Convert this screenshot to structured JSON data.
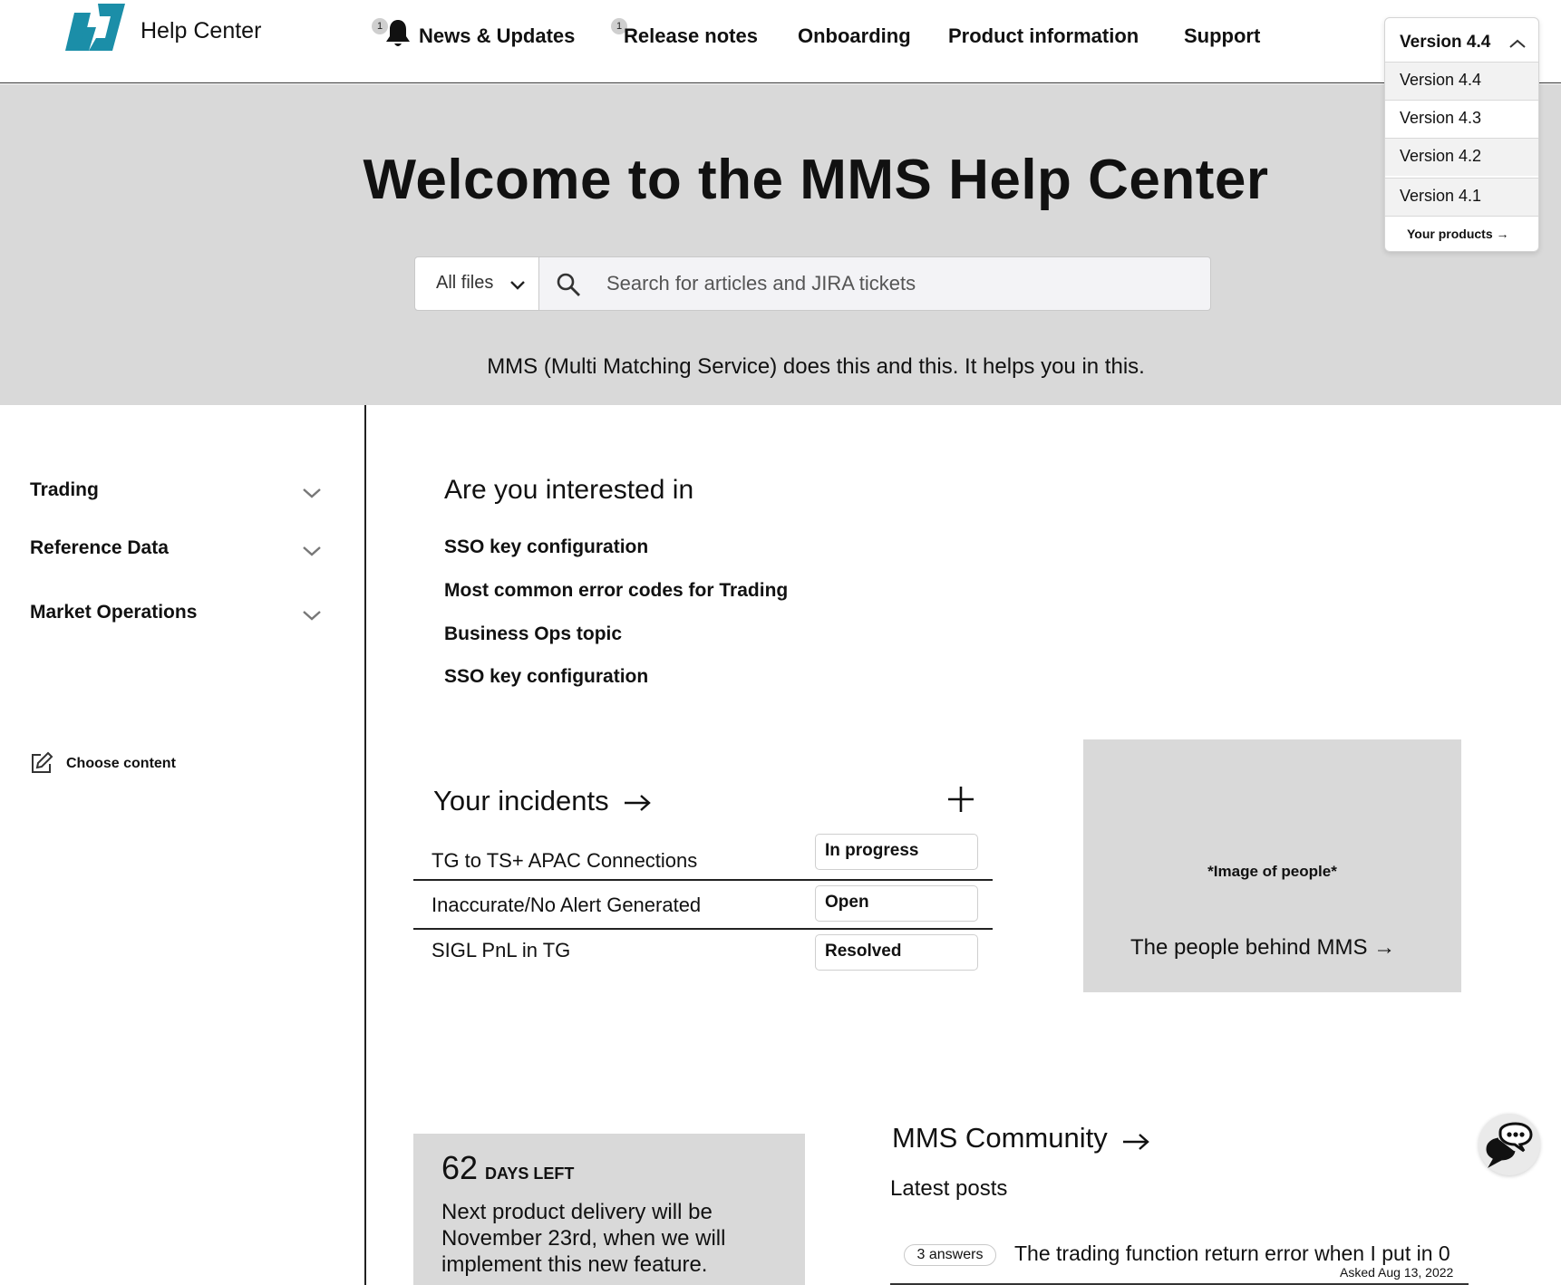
{
  "header": {
    "brand": "Help Center",
    "nav": [
      {
        "label": "News & Updates",
        "badge": "1",
        "icon": "bell-icon"
      },
      {
        "label": "Release notes",
        "badge": "1"
      },
      {
        "label": "Onboarding"
      },
      {
        "label": "Product information"
      },
      {
        "label": "Support"
      }
    ]
  },
  "version_dropdown": {
    "selected": "Version 4.4",
    "options": [
      "Version 4.4",
      "Version 4.3",
      "Version 4.2",
      "Version 4.1"
    ],
    "footer_link": "Your products →"
  },
  "hero": {
    "title": "Welcome to the MMS Help Center",
    "search": {
      "scope": "All files",
      "placeholder": "Search for articles and JIRA tickets"
    },
    "subtitle": "MMS (Multi Matching Service) does this and this. It helps you in this."
  },
  "sidebar": {
    "items": [
      {
        "label": "Trading"
      },
      {
        "label": "Reference Data"
      },
      {
        "label": "Market Operations"
      }
    ],
    "choose_content": "Choose content"
  },
  "interested": {
    "title": "Are you interested in",
    "links": [
      "SSO key configuration",
      "Most common error codes for Trading",
      "Business Ops topic",
      "SSO key configuration"
    ]
  },
  "incidents": {
    "title": "Your incidents",
    "rows": [
      {
        "name": "TG to TS+ APAC Connections",
        "status": "In progress"
      },
      {
        "name": "Inaccurate/No Alert Generated",
        "status": "Open"
      },
      {
        "name": "SIGL PnL in TG",
        "status": "Resolved"
      }
    ]
  },
  "people_card": {
    "image_label": "*Image of people*",
    "link": "The people behind MMS →"
  },
  "delivery_card": {
    "days": "62",
    "unit": "DAYS LEFT",
    "text": "Next product delivery will be November 23rd, when we will implement this new feature."
  },
  "community": {
    "title": "MMS Community",
    "subtitle": "Latest posts",
    "posts": [
      {
        "answers": "3 answers",
        "title": "The trading function return error when I put in 0",
        "meta": "Asked Aug 13, 2022"
      }
    ]
  },
  "colors": {
    "brand_teal": "#1b8ea8",
    "hero_bg": "#d9d9d9",
    "text": "#111111"
  }
}
